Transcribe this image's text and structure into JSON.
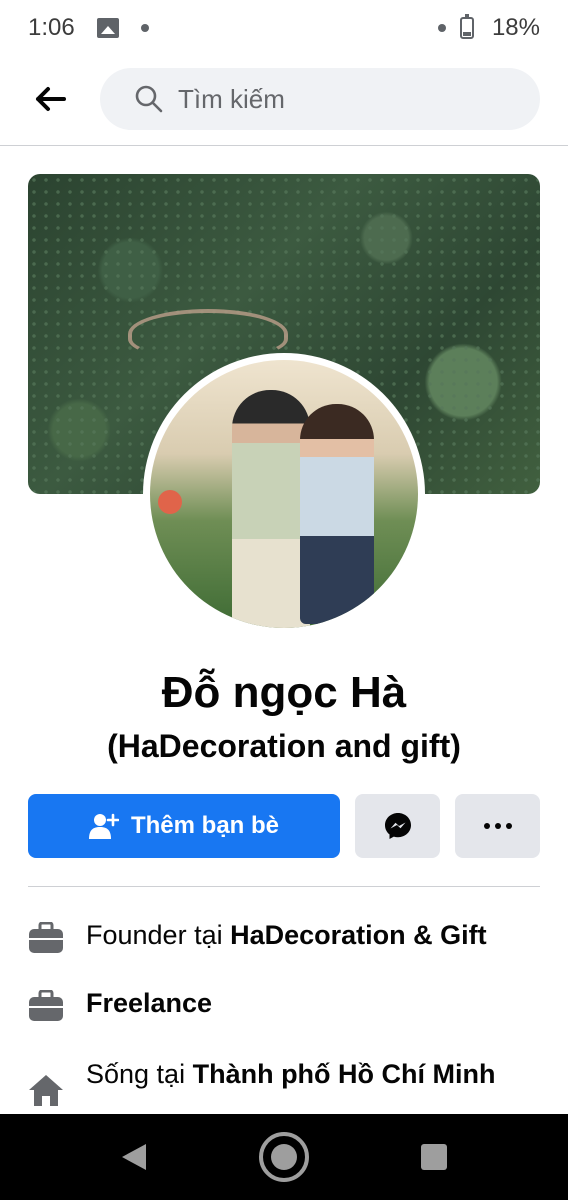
{
  "status_bar": {
    "time": "1:06",
    "battery": "18%"
  },
  "search": {
    "placeholder": "Tìm kiếm"
  },
  "profile": {
    "name": "Đỗ ngọc Hà",
    "subname": "(HaDecoration and gift)"
  },
  "actions": {
    "add_friend_label": "Thêm bạn bè"
  },
  "info": [
    {
      "icon": "briefcase-icon",
      "prefix": "Founder tại ",
      "value": "HaDecoration & Gift"
    },
    {
      "icon": "briefcase-icon",
      "prefix": "",
      "value": "Freelance"
    },
    {
      "icon": "home-icon",
      "prefix": "Sống tại ",
      "value": "Thành phố Hồ Chí Minh"
    }
  ],
  "colors": {
    "accent": "#1877f2",
    "secondary_button": "#e4e6eb",
    "search_bg": "#f0f2f5"
  }
}
